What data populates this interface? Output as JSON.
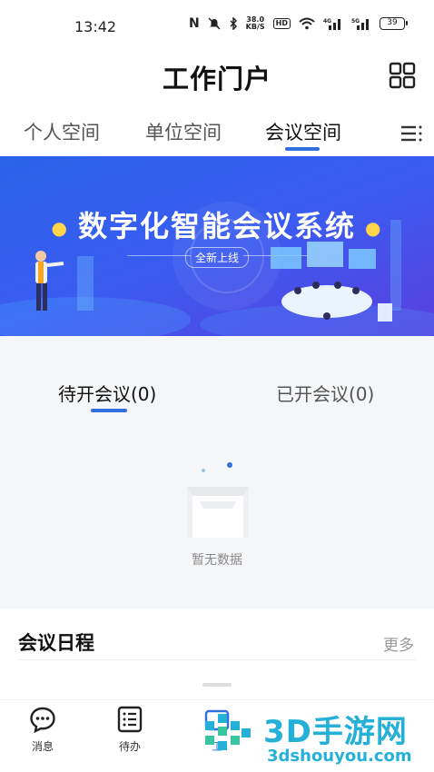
{
  "status_bar": {
    "time": "13:42",
    "speed_value": "38.0",
    "speed_unit": "KB/S",
    "hd": "HD",
    "battery": "39",
    "signal_a": "4G",
    "signal_b": "5G"
  },
  "header": {
    "title": "工作门户"
  },
  "tabs": [
    {
      "label": "个人空间",
      "active": false
    },
    {
      "label": "单位空间",
      "active": false
    },
    {
      "label": "会议空间",
      "active": true
    }
  ],
  "banner": {
    "title": "数字化智能会议系统",
    "subtitle": "全新上线"
  },
  "meeting_tabs": {
    "pending": "待开会议(0)",
    "done": "已开会议(0)"
  },
  "empty_state": {
    "text": "暂无数据"
  },
  "schedule": {
    "title": "会议日程",
    "more": "更多"
  },
  "bottom_nav": {
    "items": [
      {
        "label": "消息",
        "icon": "chat-icon"
      },
      {
        "label": "待办",
        "icon": "list-icon"
      },
      {
        "label": "工",
        "icon": "workspace-icon"
      }
    ]
  },
  "watermark": {
    "brand": "3D手游网",
    "url": "3dshouyou.com"
  },
  "colors": {
    "accent": "#2f6fe0",
    "banner_start": "#2a63ea",
    "banner_end": "#5a3fe0",
    "watermark": "#25b0d8"
  }
}
